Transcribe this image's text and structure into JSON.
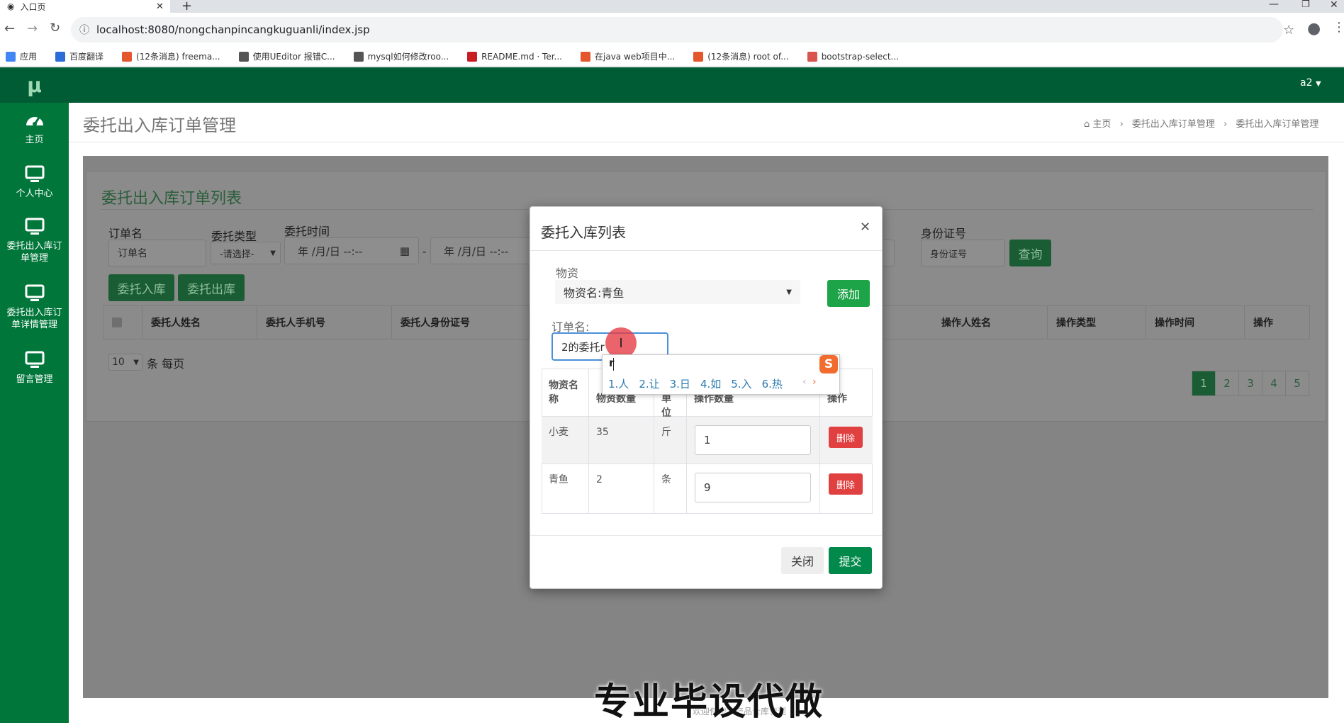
{
  "browser": {
    "tab_title": "入口页",
    "url": "localhost:8080/nongchanpincangkuguanli/index.jsp",
    "bookmarks": [
      {
        "label": "应用",
        "color": "#4285f4"
      },
      {
        "label": "百度翻译",
        "color": "#2c6cd8"
      },
      {
        "label": "(12条消息) freema...",
        "color": "#e4572e"
      },
      {
        "label": "使用UEditor 报错C...",
        "color": "#555555"
      },
      {
        "label": "mysql如何修改roo...",
        "color": "#555555"
      },
      {
        "label": "README.md · Ter...",
        "color": "#c71d23"
      },
      {
        "label": "在java web项目中...",
        "color": "#e4572e"
      },
      {
        "label": "(12条消息) root of...",
        "color": "#e4572e"
      },
      {
        "label": "bootstrap-select...",
        "color": "#d9534f"
      }
    ]
  },
  "sidebar": {
    "logo": "μ",
    "items": [
      {
        "label": "主页",
        "icon": "dashboard-icon"
      },
      {
        "label": "个人中心",
        "icon": "monitor-icon"
      },
      {
        "label": "委托出入库订单管理",
        "icon": "monitor-icon"
      },
      {
        "label": "委托出入库订单详情管理",
        "icon": "monitor-icon"
      },
      {
        "label": "留言管理",
        "icon": "monitor-icon"
      }
    ]
  },
  "topbar": {
    "user": "a2"
  },
  "header": {
    "title": "委托出入库订单管理",
    "breadcrumb": [
      "主页",
      "委托出入库订单管理",
      "委托出入库订单管理"
    ]
  },
  "panel": {
    "title": "委托出入库订单列表",
    "filters": {
      "order_name_label": "订单名",
      "order_name_placeholder": "订单名",
      "type_label": "委托类型",
      "type_value": "-请选择-",
      "time_label": "委托时间",
      "time_start": "年 /月/日 --:--",
      "time_end": "年 /月/日 --:--",
      "id_label": "身份证号",
      "id_placeholder": "身份证号",
      "search_button": "查询"
    },
    "buttons": {
      "in": "委托入库",
      "out": "委托出库"
    },
    "columns_left": [
      "委托人姓名",
      "委托人手机号",
      "委托人身份证号"
    ],
    "columns_right": [
      "操作人姓名",
      "操作类型",
      "操作时间",
      "操作"
    ],
    "page_size": "10",
    "page_size_suffix": "条 每页",
    "pages": [
      "1",
      "2",
      "3",
      "4",
      "5"
    ]
  },
  "modal": {
    "title": "委托入库列表",
    "goods_label": "物资",
    "goods_selected": "物资名:青鱼",
    "add_button": "添加",
    "order_label": "订单名:",
    "order_value": "2的委托r",
    "columns": [
      "物资名称",
      "物资数量",
      "单位",
      "操作数量",
      "操作"
    ],
    "rows": [
      {
        "name": "小麦",
        "count": "35",
        "unit": "斤",
        "qty": "1",
        "action": "删除"
      },
      {
        "name": "青鱼",
        "count": "2",
        "unit": "条",
        "qty": "9",
        "action": "删除"
      }
    ],
    "close_button": "关闭",
    "submit_button": "提交"
  },
  "ime": {
    "composition": "r",
    "candidates": [
      "1.人",
      "2.让",
      "3.日",
      "4.如",
      "5.入",
      "6.热"
    ]
  },
  "footer": {
    "text": "欢迎使用农产品仓库管理"
  },
  "watermark": "专业毕设代做",
  "colors": {
    "brand": "#00763a",
    "dark_brand": "#005c34",
    "danger": "#e04040",
    "submit": "#00894a"
  }
}
